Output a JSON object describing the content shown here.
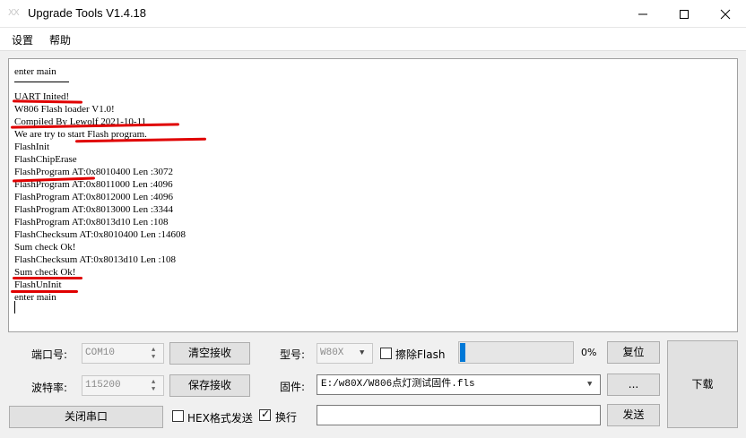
{
  "window": {
    "title": "Upgrade Tools V1.4.18",
    "icon": "app-icon",
    "icon_glyph": "XX"
  },
  "menu": {
    "items": [
      "设置",
      "帮助"
    ]
  },
  "console": {
    "lines": [
      "enter main",
      "",
      "UART Inited!",
      "W806 Flash loader V1.0!",
      "Compiled By Lewolf 2021-10-11",
      "We are try to start Flash program.",
      "FlashInit",
      "FlashChipErase",
      "FlashProgram AT:0x8010400 Len :3072",
      "FlashProgram AT:0x8011000 Len :4096",
      "FlashProgram AT:0x8012000 Len :4096",
      "FlashProgram AT:0x8013000 Len :3344",
      "FlashProgram AT:0x8013d10 Len :108",
      "FlashChecksum AT:0x8010400 Len :14608",
      "Sum check Ok!",
      "FlashChecksum AT:0x8013d10 Len :108",
      "Sum check Ok!",
      "FlashUnInit",
      "enter main"
    ],
    "annotation_color": "#e00000"
  },
  "serial": {
    "port_label": "端口号:",
    "port_value": "COM10",
    "baud_label": "波特率:",
    "baud_value": "115200",
    "clear_button": "清空接收",
    "save_button": "保存接收",
    "close_port_button": "关闭串口"
  },
  "device": {
    "model_label": "型号:",
    "model_value": "W80X",
    "erase_flash_label": "擦除Flash",
    "erase_flash_checked": false,
    "progress_percent": 5,
    "progress_text": "0%",
    "reset_button": "复位",
    "download_button": "下载",
    "firmware_label": "固件:",
    "firmware_value": "E:/w80X/W806点灯测试固件.fls",
    "browse_button": "...",
    "accent_color": "#0078d7"
  },
  "send": {
    "hex_send_label": "HEX格式发送",
    "hex_send_checked": false,
    "newline_label": "换行",
    "newline_checked": true,
    "send_input_value": "",
    "send_button": "发送"
  }
}
